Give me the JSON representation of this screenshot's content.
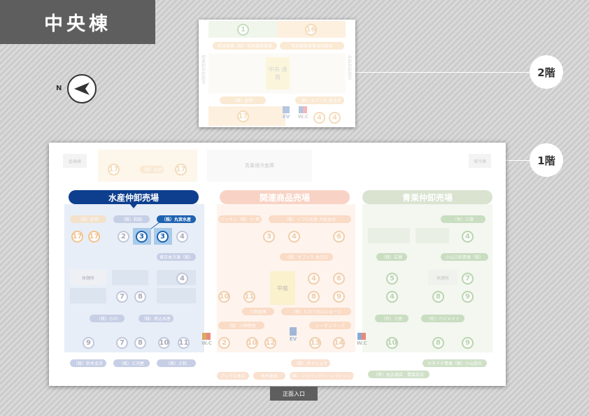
{
  "header": {
    "title": "中央棟"
  },
  "compass": {
    "label": "N"
  },
  "floors": {
    "floor2_label": "2階",
    "floor1_label": "1階"
  },
  "entrance": {
    "label": "正面入口"
  },
  "colors": {
    "marine": "#0e3f8f",
    "related": "#f5b6a0",
    "produce": "#c9d8bd",
    "highlight": "#1e63b0"
  },
  "floor2": {
    "pills": [
      "荒井商事（株）荒井燐家商事",
      "荒井燐家食事協同組合",
      "（株）紀伊",
      "（株）セブンネ 本庄店"
    ],
    "side_left": "精果卸 仲卸組合",
    "side_right": "仲卸 仲卸組合",
    "center_block": "中央 通路",
    "nums": [
      "1",
      "16",
      "17",
      "4",
      "4"
    ],
    "ev": "EV",
    "wc": "W.C"
  },
  "floor1": {
    "corner_labels": [
      "倉庫棟",
      "青果保冷倉庫",
      "保冷庫"
    ],
    "top_nums": [
      "17",
      "17"
    ],
    "top_pill": "（株）紀伊",
    "categories": [
      {
        "label": "水産仲卸売場",
        "color": "#0e3f8f"
      },
      {
        "label": "関連商品売場",
        "color": "#f5b6a0"
      },
      {
        "label": "青果仲卸売場",
        "color": "#c9d8bd"
      }
    ],
    "marine_pills": [
      "（株）紀伊",
      "（株）和田",
      "（株）丸宮水産",
      "東日本冷凍（株）",
      "（株）小川",
      "（株）荷込水産",
      "（株）鈴木北洋",
      "（株）三河屋",
      "（株）三和"
    ],
    "marine_nums": [
      "17",
      "17",
      "2",
      "3",
      "3",
      "4",
      "4",
      "7",
      "8",
      "9",
      "7",
      "8",
      "10",
      "11"
    ],
    "related_pills": [
      "ツッキン（株）小 樽",
      "（株）イワロ水産 大阪食品",
      "（株）セブンネ 本庄店",
      "小野倉庫",
      "（株）ヒカリ大山ふなーど",
      "（株）川崎物産",
      "シーゲンマーズ",
      "（株）ダイショウ",
      "アックス本店",
      "有木食品",
      "（株）ジャパンクリーンフィッシュ"
    ],
    "related_nums": [
      "3",
      "4",
      "6",
      "4",
      "6",
      "10",
      "11",
      "8",
      "9",
      "2",
      "10",
      "12",
      "13",
      "14"
    ],
    "related_center": "中庭",
    "produce_pills": [
      "（有）三徳",
      "（株）岩瀬",
      "小山三和青果（株）",
      "（有）三徳",
      "（有）ベジメイト",
      "カネイチ青果（株）小山支社",
      "（有）丸久商店　青森支店"
    ],
    "produce_nums": [
      "4",
      "5",
      "7",
      "4",
      "8",
      "9",
      "10",
      "8",
      "9"
    ],
    "produce_center": "休憩所",
    "marine_center": "休憩所",
    "ev": "EV",
    "wc": "W.C"
  }
}
